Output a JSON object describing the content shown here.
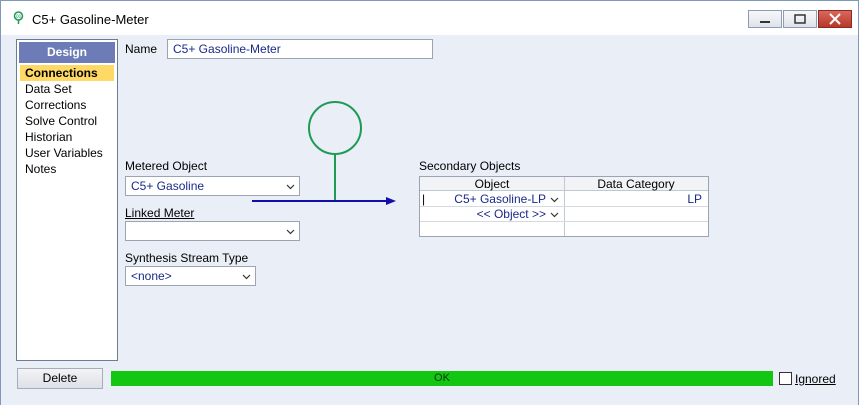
{
  "window": {
    "title": "C5+ Gasoline-Meter"
  },
  "sidebar": {
    "header": "Design",
    "items": [
      {
        "label": "Connections",
        "active": true
      },
      {
        "label": "Data Set",
        "active": false
      },
      {
        "label": "Corrections",
        "active": false
      },
      {
        "label": "Solve Control",
        "active": false
      },
      {
        "label": "Historian",
        "active": false
      },
      {
        "label": "User Variables",
        "active": false
      },
      {
        "label": "Notes",
        "active": false
      }
    ]
  },
  "form": {
    "name_label": "Name",
    "name_value": "C5+ Gasoline-Meter",
    "metered_object_label": "Metered Object",
    "metered_object_value": "C5+ Gasoline",
    "linked_meter_label": "Linked Meter",
    "linked_meter_value": "",
    "synthesis_stream_type_label": "Synthesis Stream Type",
    "synthesis_stream_type_value": "<none>"
  },
  "secondary_objects": {
    "title": "Secondary Objects",
    "columns": [
      "Object",
      "Data Category"
    ],
    "rows": [
      {
        "object": "C5+ Gasoline-LP",
        "category": "LP"
      },
      {
        "object": "<< Object >>",
        "category": ""
      }
    ]
  },
  "footer": {
    "delete_label": "Delete",
    "status_text": "OK",
    "ignored_label": "Ignored"
  },
  "colors": {
    "sidebar_header": "#6d7cb7",
    "sidebar_active": "#ffd966",
    "status_ok": "#12c612",
    "meter_symbol": "#1f9a55",
    "stream_arrow": "#1010a8"
  }
}
